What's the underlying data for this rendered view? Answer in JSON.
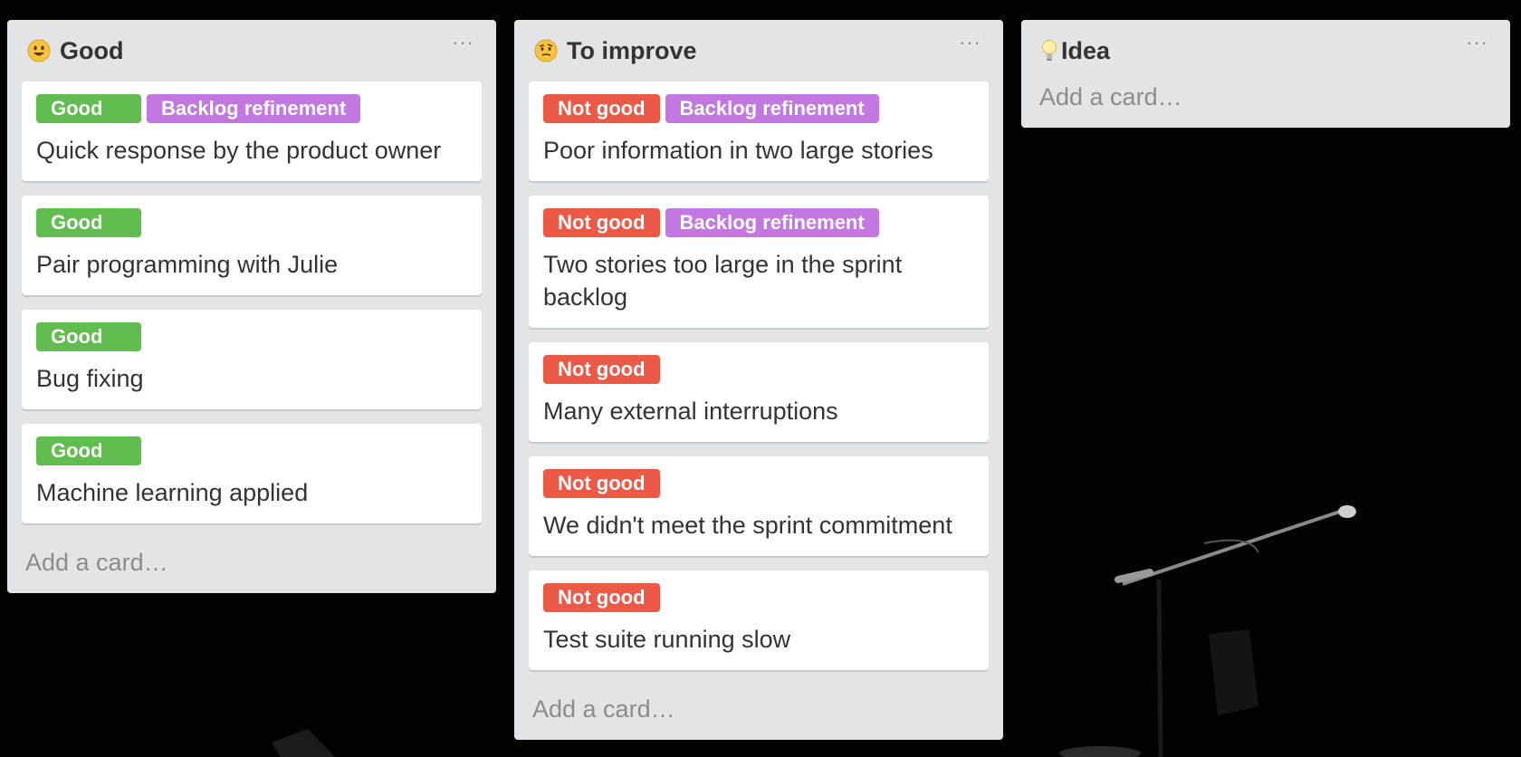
{
  "lists": [
    {
      "title": "Good",
      "emoji": "smiley-face-icon",
      "cards": [
        {
          "labels": [
            "Good",
            "Backlog refinement"
          ],
          "text": "Quick response by the product owner"
        },
        {
          "labels": [
            "Good"
          ],
          "text": "Pair programming with Julie"
        },
        {
          "labels": [
            "Good"
          ],
          "text": "Bug fixing"
        },
        {
          "labels": [
            "Good"
          ],
          "text": "Machine learning applied"
        }
      ],
      "add_card": "Add a card…"
    },
    {
      "title": "To improve",
      "emoji": "thinking-face-icon",
      "cards": [
        {
          "labels": [
            "Not good",
            "Backlog refinement"
          ],
          "text": "Poor information in two large stories"
        },
        {
          "labels": [
            "Not good",
            "Backlog refinement"
          ],
          "text": "Two stories too large in the sprint backlog"
        },
        {
          "labels": [
            "Not good"
          ],
          "text": "Many external interruptions"
        },
        {
          "labels": [
            "Not good"
          ],
          "text": "We didn't meet the sprint commitment"
        },
        {
          "labels": [
            "Not good"
          ],
          "text": "Test suite running slow"
        }
      ],
      "add_card": "Add a card…"
    },
    {
      "title": "Idea",
      "emoji": "lightbulb-icon",
      "cards": [],
      "add_card": "Add a card…"
    }
  ],
  "menu_icon": "ellipsis-icon",
  "colors": {
    "good": "#61bd4f",
    "not_good": "#eb5a46",
    "backlog_refinement": "#c377e0",
    "list_bg": "#e2e4e6"
  }
}
